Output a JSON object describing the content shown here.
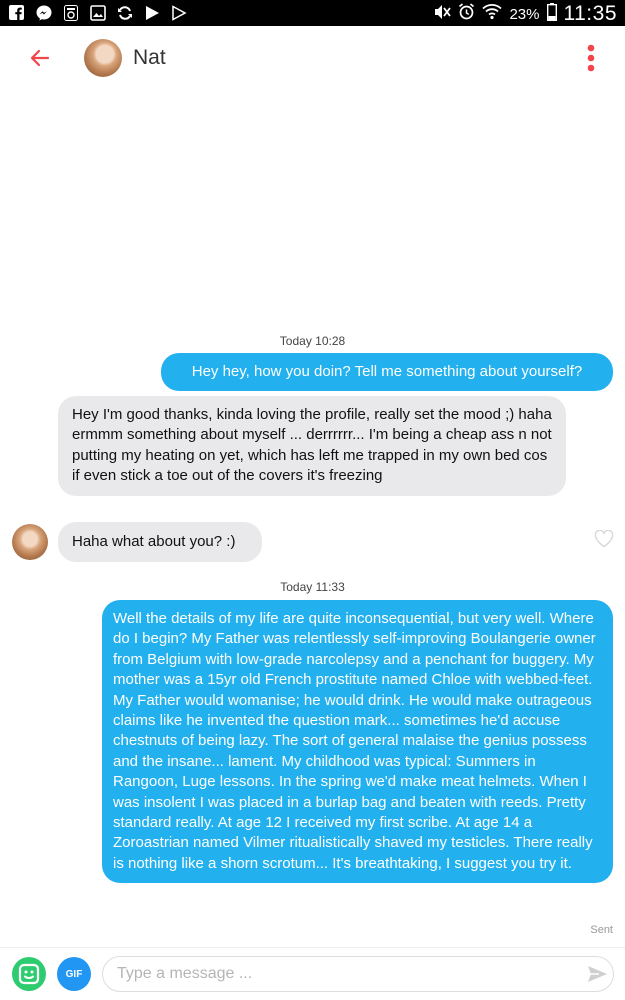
{
  "status_bar": {
    "battery_text": "23%",
    "time": "11:35",
    "left_icons": [
      "facebook-icon",
      "messenger-icon",
      "radio-icon",
      "gallery-icon",
      "sync-icon",
      "play-icon",
      "play-outline-icon"
    ],
    "right_icons": [
      "mute-icon",
      "alarm-icon",
      "wifi-icon",
      "battery-icon"
    ]
  },
  "header": {
    "contact_name": "Nat",
    "accent_color": "#f0454b"
  },
  "conversation": {
    "timestamp_1": "Today 10:28",
    "msg_1": "Hey hey, how you doin? Tell me something about yourself?",
    "msg_2": "Hey I'm good thanks, kinda loving the profile, really set the mood ;) haha ermmm something about myself ... derrrrrr... I'm being a cheap ass n not putting my heating on yet, which has left me trapped in my own bed cos if even stick a toe out of the covers it's freezing",
    "msg_3": "Haha what about you? :)",
    "timestamp_2": "Today 11:33",
    "msg_4": "Well the details of my life are quite inconsequential, but very well. Where do I begin? My Father was relentlessly self-improving Boulangerie owner from Belgium with low-grade narcolepsy and a penchant for buggery. My mother was a 15yr old French prostitute named Chloe with webbed-feet. My Father would womanise; he would drink. He would make outrageous claims like he invented the question mark... sometimes he'd accuse chestnuts of being lazy. The sort of general malaise the genius possess and the insane... lament. My childhood was typical: Summers in Rangoon, Luge lessons. In the spring we'd make meat helmets. When I was insolent I was placed in a burlap bag and beaten with reeds. Pretty standard really. At age 12 I received my first scribe. At age 14 a Zoroastrian named Vilmer ritualistically shaved my testicles. There really is nothing like a shorn scrotum... It's breathtaking, I suggest you try it.",
    "sent_label": "Sent",
    "outgoing_color": "#22b1ee",
    "incoming_color": "#e9e9eb"
  },
  "composer": {
    "gif_label": "GIF",
    "placeholder": "Type a message ..."
  }
}
